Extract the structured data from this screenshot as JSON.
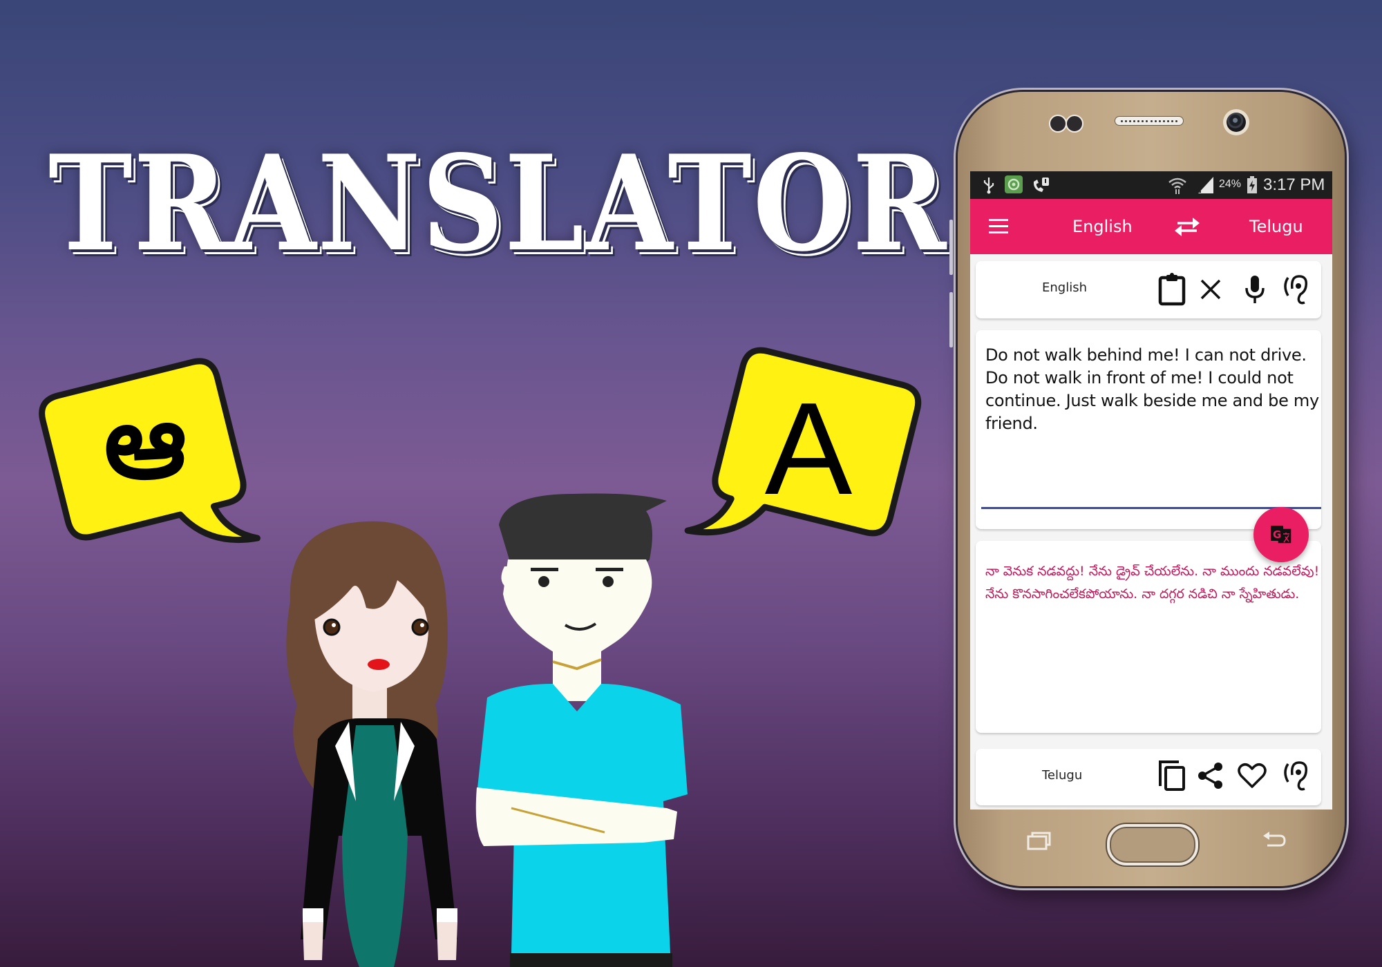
{
  "banner": {
    "title": "TRANSLATOR",
    "left_bubble_glyph": "ఆ",
    "right_bubble_glyph": "A",
    "colors": {
      "bubble_fill": "#fff212",
      "bubble_outline": "#1a1a1a",
      "background_top": "#3a4677",
      "background_mid": "#7d5a93",
      "background_bottom": "#381c3c"
    }
  },
  "phone": {
    "status_bar": {
      "left_icons": [
        "usb-icon",
        "app-notification-icon",
        "missed-call-icon"
      ],
      "wifi": "wifi-icon",
      "signal": "signal-icon",
      "battery_percent": "24%",
      "battery_icon": "battery-charging-icon",
      "time": "3:17 PM"
    },
    "app_bar": {
      "menu_icon": "hamburger-menu-icon",
      "source_language": "English",
      "swap_icon": "swap-arrows-icon",
      "target_language": "Telugu",
      "color": "#e91e63"
    },
    "input_card": {
      "language_label": "English",
      "actions": [
        {
          "name": "paste",
          "icon": "clipboard-icon"
        },
        {
          "name": "clear",
          "icon": "close-icon"
        },
        {
          "name": "voice-input",
          "icon": "microphone-icon"
        },
        {
          "name": "listen",
          "icon": "ear-icon"
        }
      ]
    },
    "input_text": "Do not walk behind me! I can not drive. Do not walk in front of me! I could not continue. Just walk beside me and be my friend.",
    "translate_button_icon": "google-translate-icon",
    "output_text": "నా వెనుక నడవద్దు! నేను డ్రైవ్ చేయలేను. నా ముందు నడవలేవు! నేను కొనసాగించలేకపోయాను. నా దగ్గర నడిచి నా స్నేహితుడు.",
    "output_card": {
      "language_label": "Telugu",
      "actions": [
        {
          "name": "copy",
          "icon": "copy-icon"
        },
        {
          "name": "share",
          "icon": "share-icon"
        },
        {
          "name": "favorite",
          "icon": "heart-icon"
        },
        {
          "name": "listen",
          "icon": "ear-icon"
        }
      ]
    },
    "nav_keys": [
      "recent-apps-icon",
      "home-button",
      "back-icon"
    ]
  }
}
